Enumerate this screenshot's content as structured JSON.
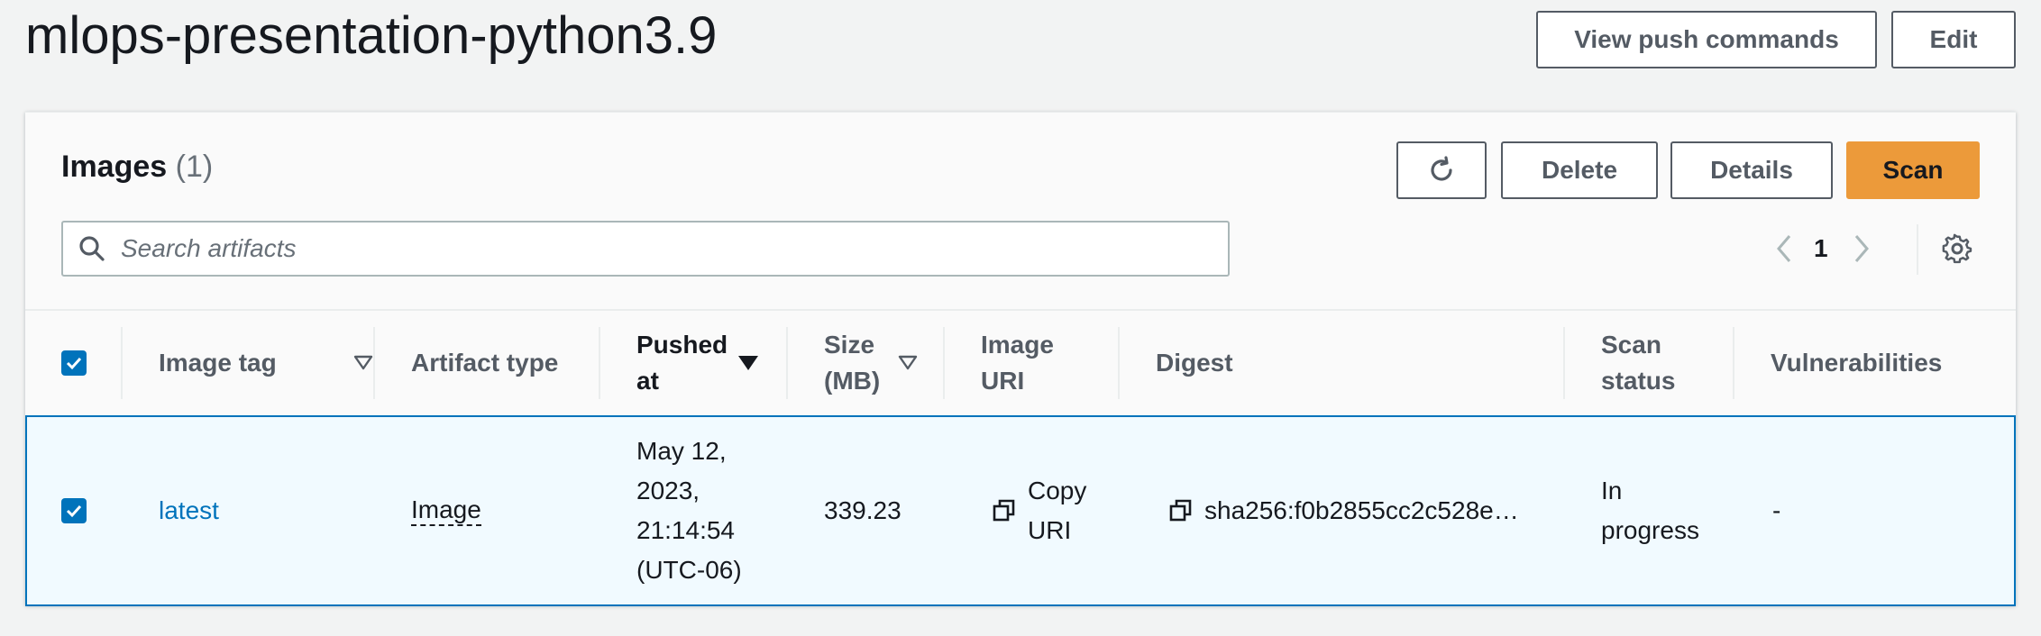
{
  "header": {
    "title": "mlops-presentation-python3.9",
    "view_push_label": "View push commands",
    "edit_label": "Edit"
  },
  "panel": {
    "title": "Images",
    "count": "(1)",
    "refresh_icon": "refresh-icon",
    "delete_label": "Delete",
    "details_label": "Details",
    "scan_label": "Scan",
    "search_placeholder": "Search artifacts",
    "page_number": "1"
  },
  "table": {
    "columns": [
      {
        "label": "Image tag",
        "sort": "filter-triangle"
      },
      {
        "label": "Artifact type"
      },
      {
        "label": "Pushed at",
        "sort": "sorted-desc"
      },
      {
        "label": "Size (MB)",
        "sort": "filter-triangle"
      },
      {
        "label": "Image URI"
      },
      {
        "label": "Digest"
      },
      {
        "label": "Scan status"
      },
      {
        "label": "Vulnerabilities"
      }
    ],
    "rows": [
      {
        "selected": true,
        "image_tag": "latest",
        "artifact_type": "Image",
        "pushed_at": "May 12, 2023, 21:14:54 (UTC-06)",
        "size_mb": "339.23",
        "image_uri": "Copy URI",
        "digest": "sha256:f0b2855cc2c528e…",
        "scan_status": "In progress",
        "vulnerabilities": "-"
      }
    ]
  },
  "colors": {
    "accent": "#0073bb",
    "primary_button": "#ec9a3a",
    "page_background": "#f2f3f3"
  }
}
